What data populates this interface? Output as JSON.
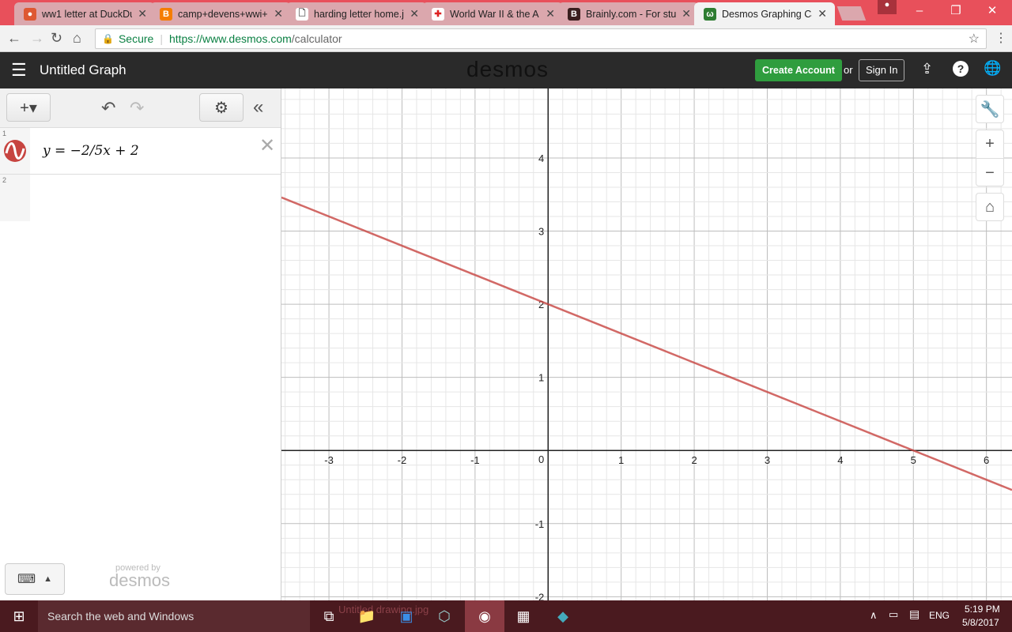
{
  "browser": {
    "tabs": [
      {
        "title": "ww1 letter at DuckDu",
        "icon": "duckduckgo-icon",
        "color": "#de5833"
      },
      {
        "title": "camp+devens+wwi+",
        "icon": "blogger-icon",
        "color": "#f57d00"
      },
      {
        "title": "harding letter home.j",
        "icon": "file-icon",
        "color": "#ffffff"
      },
      {
        "title": "World War II & the A",
        "icon": "red-cross-icon",
        "color": "#ffffff"
      },
      {
        "title": "Brainly.com - For stu",
        "icon": "brainly-icon",
        "color": "#3a1e1e"
      },
      {
        "title": "Desmos Graphing Ca",
        "icon": "desmos-icon",
        "color": "#2e7d32"
      }
    ],
    "secure_label": "Secure",
    "url_host": "https://www.desmos.com",
    "url_path": "/calculator"
  },
  "desmos": {
    "graph_title": "Untitled Graph",
    "logo": "desmos",
    "create_account": "Create Account",
    "or": "or",
    "sign_in": "Sign In",
    "expressions": [
      {
        "index": "1",
        "latex": "y = −2/5x + 2",
        "color": "#c74440"
      },
      {
        "index": "2",
        "latex": ""
      }
    ],
    "powered_by": "powered by",
    "powered_logo": "desmos"
  },
  "chart_data": {
    "type": "line",
    "series": [
      {
        "name": "y = -2/5x + 2",
        "slope": -0.4,
        "intercept": 2,
        "color": "#c74440"
      }
    ],
    "xlim": [
      -3.65,
      6.35
    ],
    "ylim": [
      -2.05,
      4.95
    ],
    "x_ticks": [
      "-3",
      "-2",
      "-1",
      "1",
      "2",
      "3",
      "4",
      "5",
      "6"
    ],
    "y_ticks": [
      "4",
      "3",
      "2",
      "1",
      "-1",
      "-2"
    ],
    "origin_label": "0",
    "grid": true
  },
  "taskbar": {
    "search_placeholder": "Search the web and Windows",
    "lang": "ENG",
    "time": "5:19 PM",
    "date": "5/8/2017",
    "download": "Untitled drawing.jpg"
  }
}
